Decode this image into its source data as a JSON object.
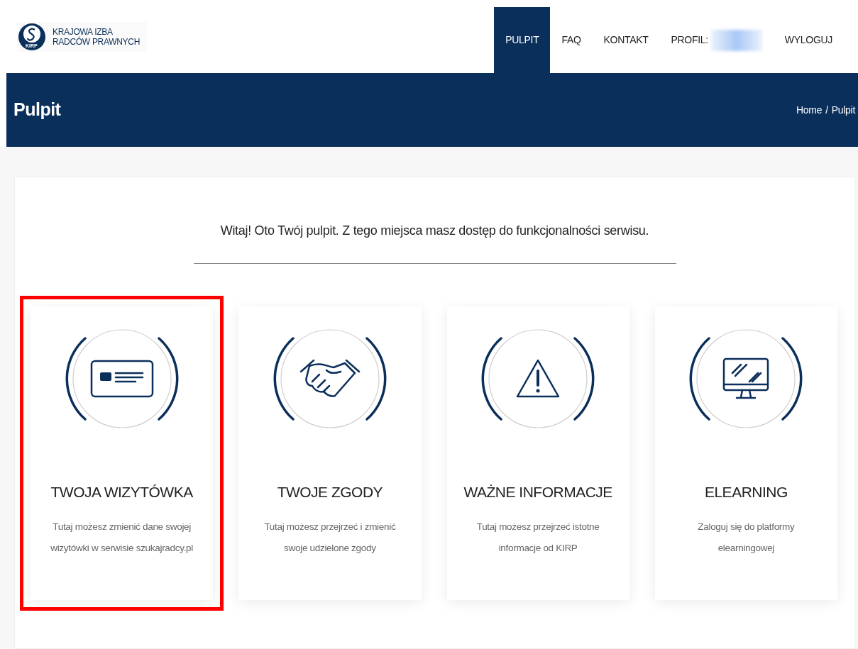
{
  "logo": {
    "line1": "KRAJOWA IZBA",
    "line2": "RADCÓW PRAWNYCH",
    "badge": "KIRP"
  },
  "nav": [
    {
      "kind": "link",
      "label": "PULPIT",
      "selected": true
    },
    {
      "kind": "link",
      "label": "FAQ",
      "selected": false
    },
    {
      "kind": "link",
      "label": "KONTAKT",
      "selected": false
    },
    {
      "kind": "profile",
      "label": "PROFIL:",
      "selected": false
    },
    {
      "kind": "link",
      "label": "WYLOGUJ",
      "selected": false
    }
  ],
  "banner": {
    "title": "Pulpit",
    "breadcrumb": [
      "Home",
      "Pulpit"
    ],
    "separator": "/"
  },
  "intro": "Witaj! Oto Twój pulpit. Z tego miejsca masz dostęp do funkcjonalności serwisu.",
  "tiles": [
    {
      "kind": "card",
      "title": "TWOJA WIZYTÓWKA",
      "description": "Tutaj możesz zmienić dane swojej wizytówki w serwisie szukajradcy.pl",
      "highlighted": true
    },
    {
      "kind": "handshake",
      "title": "TWOJE ZGODY",
      "description": "Tutaj możesz przejrzeć i zmienić swoje udzielone zgody",
      "highlighted": false
    },
    {
      "kind": "warning",
      "title": "WAŻNE INFORMACJE",
      "description": "Tutaj możesz przejrzeć istotne informacje od KIRP",
      "highlighted": false
    },
    {
      "kind": "monitor",
      "title": "ELEARNING",
      "description": "Zaloguj się do platformy elearningowej",
      "highlighted": false
    }
  ]
}
